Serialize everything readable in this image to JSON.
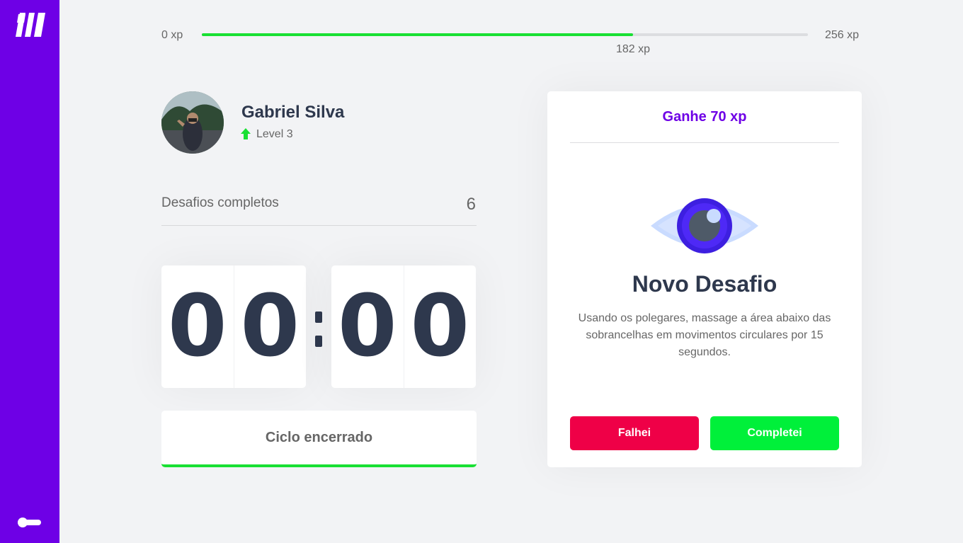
{
  "xp": {
    "min_label": "0 xp",
    "max_label": "256 xp",
    "current_label": "182 xp",
    "current": 182,
    "max": 256
  },
  "profile": {
    "name": "Gabriel Silva",
    "level_label": "Level 3"
  },
  "stats": {
    "completed_label": "Desafios completos",
    "completed_value": "6"
  },
  "countdown": {
    "minutes": [
      "0",
      "0"
    ],
    "seconds": [
      "0",
      "0"
    ]
  },
  "cycle_button": {
    "label": "Ciclo encerrado"
  },
  "challenge": {
    "reward": "Ganhe 70 xp",
    "title": "Novo Desafio",
    "description": "Usando os polegares, massage a área abaixo das sobrancelhas em movimentos circulares por 15 segundos.",
    "fail_label": "Falhei",
    "complete_label": "Completei"
  },
  "icons": {
    "logo": "logo-icon",
    "theme_toggle": "toggle-icon",
    "level": "level-up-arrow-icon",
    "challenge": "eye-icon"
  },
  "colors": {
    "sidebar": "#6E00E6",
    "accent": "#6E00E6",
    "progress": "#19E033",
    "fail": "#EF0047",
    "success": "#00F03A",
    "title_text": "#2E384D"
  }
}
